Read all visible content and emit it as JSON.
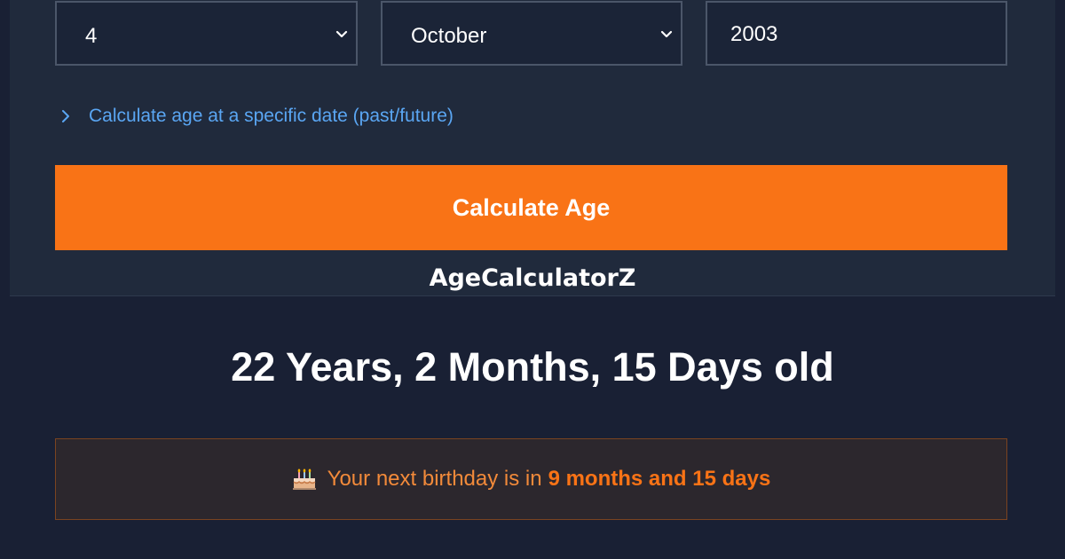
{
  "form": {
    "day_value": "4",
    "month_value": "October",
    "year_value": "2003",
    "specific_date_toggle": "Calculate age at a specific date (past/future)",
    "calculate_button": "Calculate Age"
  },
  "brand": "AgeCalculatorZ",
  "result": {
    "age_text": "22 Years, 2 Months, 15 Days old",
    "next_birthday_prefix": "Your next birthday is in",
    "next_birthday_value": "9 months and 15 days"
  },
  "colors": {
    "page_bg": "#192034",
    "card_bg": "#202a3c",
    "accent": "#f97316",
    "link": "#5aa6f3"
  },
  "icons": {
    "dropdown": "chevron-down-icon",
    "toggle": "chevron-right-icon",
    "birthday": "cake-icon"
  }
}
